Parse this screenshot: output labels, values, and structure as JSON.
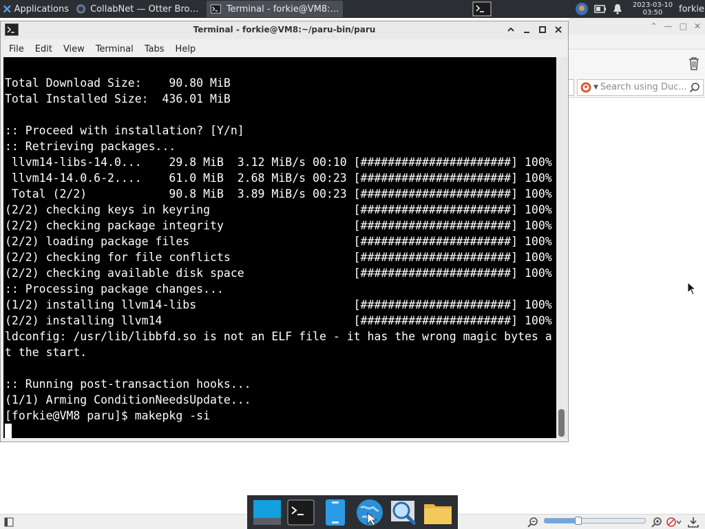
{
  "panel": {
    "applications_label": "Applications",
    "tasks": [
      {
        "label": "CollabNet — Otter Browser",
        "active": false
      },
      {
        "label": "Terminal - forkie@VM8:~/...",
        "active": true
      }
    ],
    "clock_date": "2023-03-10",
    "clock_time": "03:50",
    "user": "forkie"
  },
  "terminal": {
    "title": "Terminal - forkie@VM8:~/paru-bin/paru",
    "menu": [
      "File",
      "Edit",
      "View",
      "Terminal",
      "Tabs",
      "Help"
    ],
    "lines": [
      "Total Download Size:    90.80 MiB",
      "Total Installed Size:  436.01 MiB",
      "",
      ":: Proceed with installation? [Y/n]",
      ":: Retrieving packages...",
      " llvm14-libs-14.0...    29.8 MiB  3.12 MiB/s 00:10 [######################] 100%",
      " llvm14-14.0.6-2....    61.0 MiB  2.68 MiB/s 00:23 [######################] 100%",
      " Total (2/2)            90.8 MiB  3.89 MiB/s 00:23 [######################] 100%",
      "(2/2) checking keys in keyring                     [######################] 100%",
      "(2/2) checking package integrity                   [######################] 100%",
      "(2/2) loading package files                        [######################] 100%",
      "(2/2) checking for file conflicts                  [######################] 100%",
      "(2/2) checking available disk space                [######################] 100%",
      ":: Processing package changes...",
      "(1/2) installing llvm14-libs                       [######################] 100%",
      "(2/2) installing llvm14                            [######################] 100%",
      "ldconfig: /usr/lib/libbfd.so is not an ELF file - it has the wrong magic bytes a",
      "t the start.",
      "",
      ":: Running post-transaction hooks...",
      "(1/1) Arming ConditionNeedsUpdate...",
      "[forkie@VM8 paru]$ makepkg -si"
    ]
  },
  "browser": {
    "search_placeholder": "Search using Duc..."
  },
  "colors": {
    "panel_bg": "#2b2e33",
    "terminal_bg": "#000000",
    "terminal_fg": "#ffffff"
  }
}
